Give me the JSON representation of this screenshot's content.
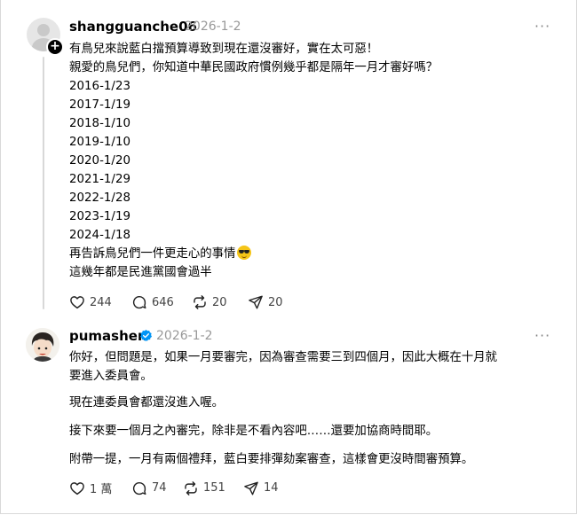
{
  "post1": {
    "username": "shangguanche06",
    "date": "2026-1-2",
    "lines": [
      "有鳥兒來說藍白擋預算導致到現在還沒審好，實在太可惡！",
      "親愛的鳥兒們，你知道中華民國政府慣例幾乎都是隔年一月才審好嗎？",
      "2016-1/23",
      "2017-1/19",
      "2018-1/10",
      "2019-1/10",
      "2020-1/20",
      "2021-1/29",
      "2022-1/28",
      "2023-1/19",
      "2024-1/18",
      "再告訴鳥兒們一件更走心的事情",
      "這幾年都是民進黨國會過半"
    ],
    "emoji_icon": "smiling-face-with-sunglasses-icon",
    "likes": "244",
    "comments": "646",
    "reposts": "20",
    "shares": "20"
  },
  "post2": {
    "username": "pumashen",
    "date": "2026-1-2",
    "verified_icon": "verified-badge-icon",
    "paragraph1_line1": "你好，但問題是，如果一月要審完，因為審查需要三到四個月，因此大概在十月就",
    "paragraph1_line2": "要進入委員會。",
    "paragraph2": "現在連委員會都還沒進入喔。",
    "paragraph3": "接下來要一個月之內審完，除非是不看內容吧……還要加協商時間耶。",
    "paragraph4": "附帶一提，一月有兩個禮拜，藍白要排彈劾案審查，這樣會更沒時間審預算。",
    "likes": "1 萬",
    "comments": "74",
    "reposts": "151",
    "shares": "14"
  },
  "more_label": "···",
  "plus_label": "+",
  "colors": {
    "secondary_text": "#999999",
    "verified_blue": "#0095f6",
    "thread_line": "#d8d8d8"
  }
}
